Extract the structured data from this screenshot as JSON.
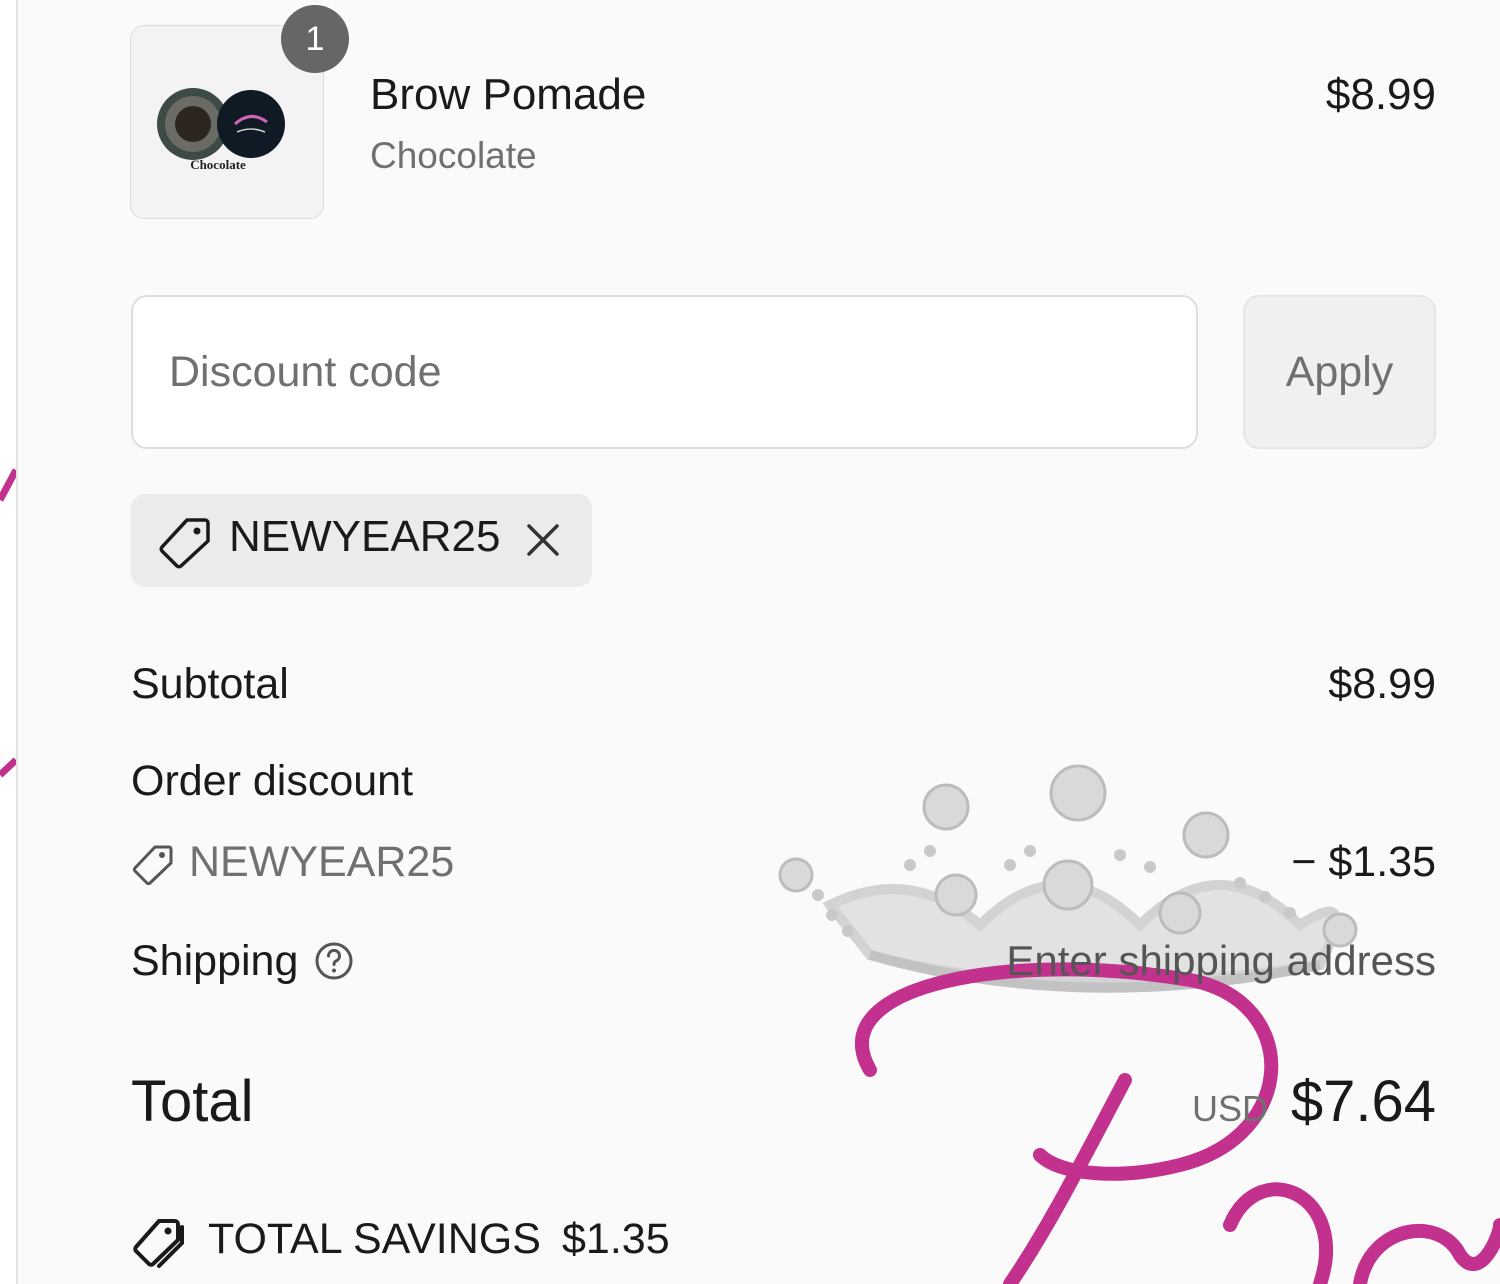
{
  "cart": {
    "item": {
      "name": "Brow Pomade",
      "variant": "Chocolate",
      "price": "$8.99",
      "quantity": "1",
      "thumbnail_caption": "Chocolate"
    }
  },
  "discount": {
    "placeholder": "Discount code",
    "value": "",
    "apply_label": "Apply",
    "applied_code": "NEWYEAR25"
  },
  "summary": {
    "subtotal_label": "Subtotal",
    "subtotal_value": "$8.99",
    "order_discount_label": "Order discount",
    "order_discount_code": "NEWYEAR25",
    "order_discount_value": "− $1.35",
    "shipping_label": "Shipping",
    "shipping_value": "Enter shipping address",
    "total_label": "Total",
    "total_currency": "USD",
    "total_value": "$7.64",
    "savings_label": "TOTAL SAVINGS",
    "savings_value": "$1.35"
  },
  "icons": {
    "chip": "tag-icon",
    "chip_remove": "close-icon",
    "discount_row": "tag-icon",
    "shipping_help": "question-circle-icon",
    "savings": "tags-icon"
  },
  "colors": {
    "background": "#fafafa",
    "badge": "#666666",
    "muted_text": "#707070",
    "watermark_pink": "#c2318e",
    "watermark_silver": "#c8c8c8"
  }
}
